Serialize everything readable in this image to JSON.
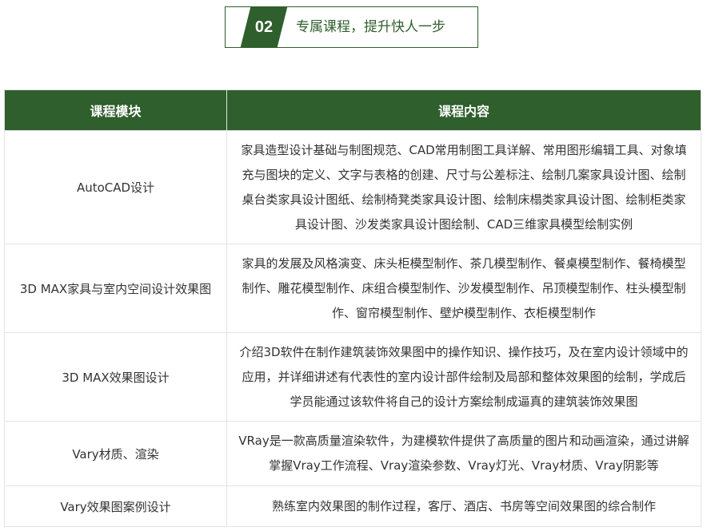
{
  "header": {
    "number": "02",
    "title": "专属课程，提升快人一步"
  },
  "table": {
    "columns": [
      "课程模块",
      "课程内容"
    ],
    "rows": [
      {
        "module": "AutoCAD设计",
        "content": "家具造型设计基础与制图规范、CAD常用制图工具详解、常用图形编辑工具、对象填充与图块的定义、文字与表格的创建、尺寸与公差标注、绘制几案家具设计图、绘制桌台类家具设计图纸、绘制椅凳类家具设计图、绘制床榻类家具设计图、绘制柜类家具设计图、沙发类家具设计图绘制、CAD三维家具模型绘制实例"
      },
      {
        "module": "3D MAX家具与室内空间设计效果图",
        "content": "家具的发展及风格演变、床头柜模型制作、茶几模型制作、餐桌模型制作、餐椅模型制作、雕花模型制作、床组合模型制作、沙发模型制作、吊顶模型制作、柱头模型制作、窗帘模型制作、壁炉模型制作、衣柜模型制作"
      },
      {
        "module": "3D MAX效果图设计",
        "content": "介绍3D软件在制作建筑装饰效果图中的操作知识、操作技巧，及在室内设计领域中的应用，并详细讲述有代表性的室内设计部件绘制及局部和整体效果图的绘制，学成后学员能通过该软件将自己的设计方案绘制成逼真的建筑装饰效果图"
      },
      {
        "module": "Vary材质、渲染",
        "content": "VRay是一款高质量渲染软件，为建模软件提供了高质量的图片和动画渲染，通过讲解掌握Vray工作流程、Vray渲染参数、Vray灯光、Vray材质、Vray阴影等"
      },
      {
        "module": "Vary效果图案例设计",
        "content": "熟练室内效果图的制作过程，客厅、酒店、书房等空间效果图的综合制作"
      }
    ]
  }
}
